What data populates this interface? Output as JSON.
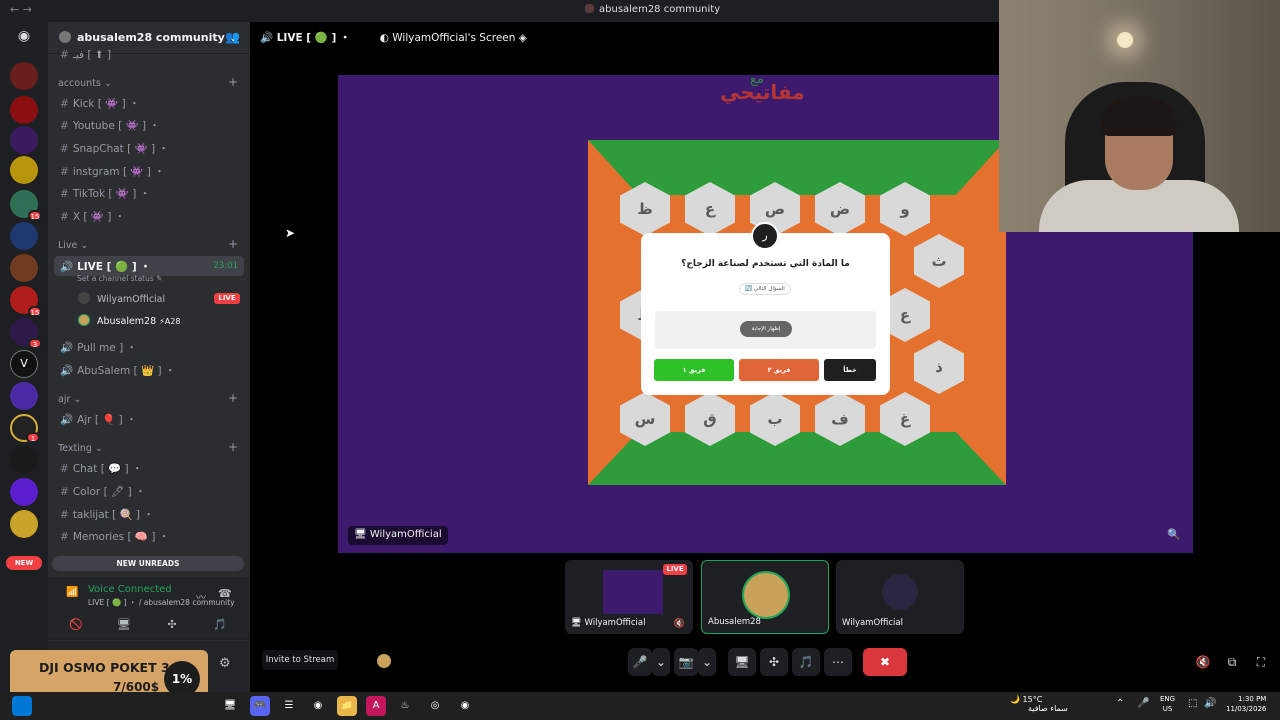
{
  "window": {
    "title": "abusalem28 community",
    "back": "←",
    "forward": "→"
  },
  "server": {
    "name": "abusalem28 community",
    "dropdown": "⌄",
    "add_member": "👥"
  },
  "guild_badges": {
    "g6": "15",
    "g9": "15",
    "g10": "3",
    "g13": "1"
  },
  "guild_letter": "V",
  "new_pill": "NEW",
  "categories": {
    "accounts": "accounts",
    "live": "Live",
    "ajr": "ajr",
    "texting": "Texting"
  },
  "channels": {
    "partial": "فيـ [ ⬆ ]",
    "kick": "Kick [ 👾 ] ・",
    "youtube": "Youtube [ 👾 ] ・",
    "snapchat": "SnapChat [ 👾 ] ・",
    "instgram": "instgram [ 👾 ] ・",
    "tiktok": "TikTok [ 👾 ] ・",
    "x": "X [ 👾 ] ・",
    "live": "LIVE [ 🟢 ] ・",
    "live_time": "23:01",
    "live_status": "Set a channel status ✎",
    "pull_me": "Pull me ] ・",
    "abusalem": "AbuSalem [ 👑 ] ・",
    "ajr": "Ajr [ 🎈 ] ・",
    "chat": "Chat [ 💬 ] ・",
    "color": "Color [ 🖊 ] ・",
    "taklijat": "taklijat [ 🍭 ] ・",
    "memories": "Memories [ 🧠 ] ・"
  },
  "voice_users": [
    {
      "name": "WilyamOfficial",
      "tag": "LIVE"
    },
    {
      "name": "Abusalem28",
      "tag": "⚡A28"
    }
  ],
  "new_unreads": "NEW UNREADS",
  "voice": {
    "status": "Voice Connected",
    "location": "LIVE [ 🟢 ] ・ / abusalem28 community",
    "signal": "📶",
    "wave": "〰",
    "hangup": "☎"
  },
  "voice_buttons": [
    "🚫",
    "🖥",
    "✣",
    "🎵"
  ],
  "promo": {
    "title": "DJI OSMO POKET 3",
    "value": "7/600$",
    "percent": "1%"
  },
  "settings": "⚙",
  "stage": {
    "live_label": "LIVE [ 🟢 ] ・",
    "screen_title": "WilyamOfficial's Screen",
    "stream_name": "WilyamOfficial",
    "zoom": "🔍"
  },
  "game": {
    "logo_top": "مع",
    "logo": "مفاتيحي",
    "hex_letters": [
      "ظ",
      "ع",
      "ص",
      "ض",
      "و",
      "ث",
      "ع",
      "ذ",
      "غ",
      "ف",
      "ب",
      "ق",
      "س",
      "ط"
    ],
    "question": "ما المادة التي تستخدم لصناعة الزجاج؟",
    "tag": "🔄 السؤال التالي",
    "badge": "ر",
    "show_answer": "إظهار الإجابة",
    "team_green": "فريق ١",
    "team_orange": "فريق ٢",
    "wrong": "خطأ"
  },
  "tiles": [
    {
      "name": "WilyamOfficial",
      "live": "LIVE",
      "mute": "🔇"
    },
    {
      "name": "Abusalem28"
    },
    {
      "name": "WilyamOfficial"
    }
  ],
  "invite": "Invite to Stream",
  "controls": [
    "🎤",
    "⌄",
    "📷",
    "⌄",
    "🖥",
    "✣",
    "🎵",
    "⋯",
    "✖"
  ],
  "stage_icons": [
    "🔇",
    "⧉",
    "⛶"
  ],
  "taskbar": {
    "weather_temp": "15°C",
    "weather_desc": "سماء صافية",
    "lang_1": "ENG",
    "lang_2": "US",
    "time": "1:30 PM",
    "date": "11/03/2026",
    "apps": [
      "🖥",
      "☰",
      "🎮",
      "⌁",
      "◉",
      "📁",
      "A",
      "♨",
      "◎",
      "◉"
    ],
    "tray": [
      "⌃",
      "🎤",
      "⬚",
      "🔊"
    ]
  },
  "colors": {
    "accent_green": "#23a55a",
    "live_red": "#f23f43",
    "sidebar": "#2b2d31",
    "rail": "#1e1f22"
  }
}
